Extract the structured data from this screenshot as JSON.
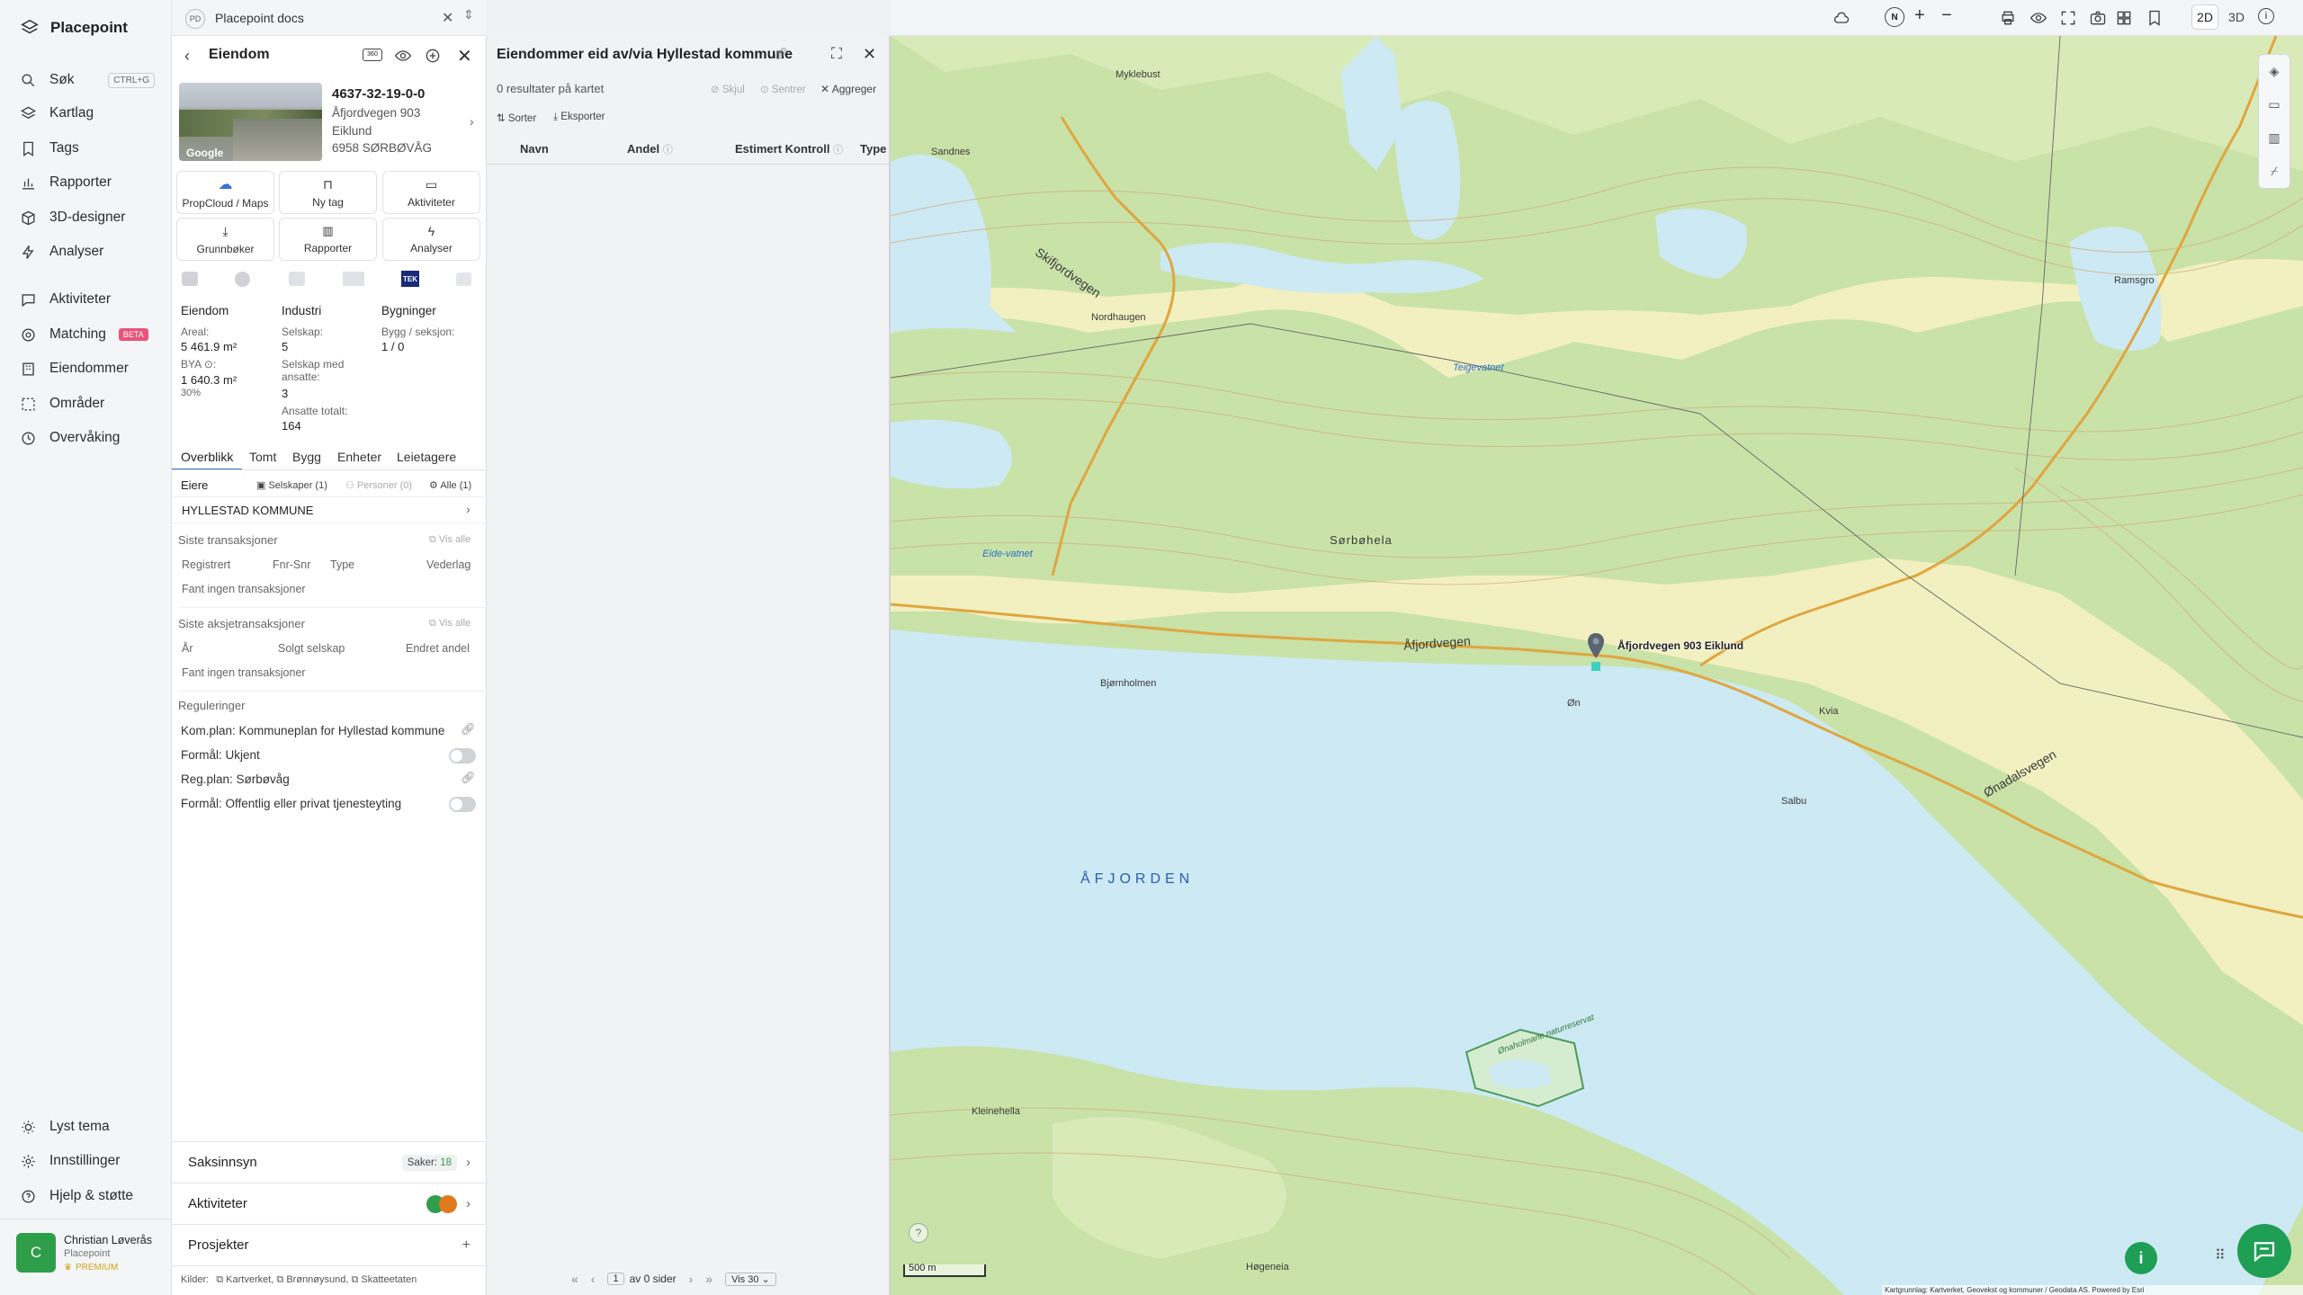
{
  "app": {
    "name": "Placepoint"
  },
  "nav": {
    "search": "Søk",
    "search_shortcut": "CTRL+G",
    "layers": "Kartlag",
    "tags": "Tags",
    "reports": "Rapporter",
    "designer": "3D-designer",
    "analyses": "Analyser",
    "activities": "Aktiviteter",
    "matching": "Matching",
    "matching_badge": "BETA",
    "properties": "Eiendommer",
    "areas": "Områder",
    "monitoring": "Overvåking",
    "theme": "Lyst tema",
    "settings": "Innstillinger",
    "help": "Hjelp & støtte",
    "user_initial": "C",
    "user_name": "Christian Løverås",
    "user_org": "Placepoint",
    "user_plan": "PREMIUM"
  },
  "workspace": {
    "badge": "PD",
    "name": "Placepoint docs"
  },
  "property": {
    "panel_title": "Eiendom",
    "image_credit": "Google",
    "id": "4637-32-19-0-0",
    "address": "Åfjordvegen 903",
    "place": "Eiklund",
    "postal": "6958 SØRBØVÅG",
    "actions": [
      "PropCloud / Maps",
      "Ny tag",
      "Aktiviteter",
      "Grunnbøker",
      "Rapporter",
      "Analyser"
    ],
    "stats": {
      "col1_title": "Eiendom",
      "areal_label": "Areal:",
      "areal_value": "5 461.9 m²",
      "bya_label": "BYA ⊙:",
      "bya_value": "1 640.3 m²",
      "bya_pct": "30%",
      "col2_title": "Industri",
      "selskap_label": "Selskap:",
      "selskap_value": "5",
      "ansatte_label": "Selskap med ansatte:",
      "ansatte_value": "3",
      "total_label": "Ansatte totalt:",
      "total_value": "164",
      "col3_title": "Bygninger",
      "bygg_label": "Bygg / seksjon:",
      "bygg_value": "1 / 0"
    },
    "tabs": [
      "Overblikk",
      "Tomt",
      "Bygg",
      "Enheter",
      "Leietagere"
    ],
    "owners": {
      "label": "Eiere",
      "companies": "Selskaper (1)",
      "persons": "Personer (0)",
      "all": "Alle (1)",
      "owner": "HYLLESTAD KOMMUNE"
    },
    "transactions": {
      "title": "Siste transaksjoner",
      "view_all": "Vis alle",
      "cols": [
        "Registrert",
        "Fnr-Snr",
        "Type",
        "Vederlag"
      ],
      "empty": "Fant ingen transaksjoner"
    },
    "share_tx": {
      "title": "Siste aksjetransaksjoner",
      "view_all": "Vis alle",
      "cols": [
        "År",
        "Solgt selskap",
        "Endret andel"
      ],
      "empty": "Fant ingen transaksjoner"
    },
    "regulations": {
      "title": "Reguleringer",
      "kommuneplan": "Kom.plan: Kommuneplan for Hyllestad kommune",
      "formal1": "Formål: Ukjent",
      "regplan": "Reg.plan: Sørbøvåg",
      "formal2": "Formål: Offentlig eller privat tjenesteyting"
    },
    "sections": {
      "case": "Saksinnsyn",
      "case_count_label": "Saker:",
      "case_count": "18",
      "activities": "Aktiviteter",
      "projects": "Prosjekter"
    },
    "sources": {
      "label": "Kilder:",
      "items": [
        "Kartverket,",
        "Brønnøysund,",
        "Skatteetaten"
      ]
    }
  },
  "list": {
    "title": "Eiendommer eid av/via Hyllestad kommune",
    "results": "0 resultater på kartet",
    "hide": "Skjul",
    "center": "Sentrer",
    "aggregate": "Aggreger",
    "sort": "Sorter",
    "export": "Eksporter",
    "cols": [
      "Navn",
      "Andel",
      "Estimert Kontroll",
      "Type"
    ],
    "pager": {
      "page": "1",
      "of": "av 0 sider",
      "show": "Vis 30"
    }
  },
  "map": {
    "mode2d": "2D",
    "mode3d": "3D",
    "scale": "500 m",
    "attribution": "Kartgrunnlag: Kartverket, Geovekst og kommuner / Geodata AS. Powered by Esri",
    "marker_label": "Åfjordvegen 903 Eiklund",
    "labels": {
      "fjord": "ÅFJORDEN",
      "afjordvegen": "Åfjordvegen",
      "onadalsvegen": "Ønadalsvegen",
      "skifjordvegen": "Skifjordvegen",
      "teigevatnet": "Teigevatnet",
      "sorbohela": "Sørbøhela",
      "eikevatnet": "Eide-vatnet",
      "nordhaugen": "Nordhaugen",
      "onaholmane": "Ønaholmane naturreservat",
      "bjornholmen": "Bjørnholmen",
      "on": "Øn",
      "salbu": "Salbu",
      "kvia": "Kvia",
      "ramsgro": "Ramsgro",
      "sandnes": "Sandnes",
      "myklebust": "Myklebust",
      "hogeneia": "Høgeneia",
      "kleinehella": "Kleinehella"
    },
    "colors": {
      "water": "#cde9f3",
      "forest": "#c9e2a8",
      "open": "#f2f0c0",
      "contour": "#c9a06a"
    }
  }
}
